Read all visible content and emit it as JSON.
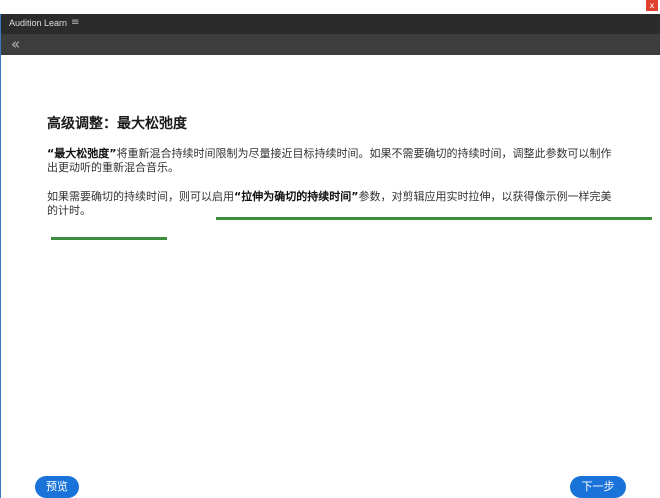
{
  "window": {
    "title": "Audition Learn",
    "close_label": "x"
  },
  "nav": {
    "back_glyph": "«",
    "menu_glyph": "≡"
  },
  "content": {
    "heading": "高级调整：最大松弛度",
    "p1_bold": "“最大松弛度”",
    "p1_rest": "将重新混合持续时间限制为尽量接近目标持续时间。如果不需要确切的持续时间，调整此参数可以制作出更动听的重新混合音乐。",
    "p2_start": "如果需要确切的持续时间，则可以启用",
    "p2_bold": "“拉伸为确切的持续时间”",
    "p2_end": "参数，对剪辑应用实时拉伸，以获得像示例一样完美的计时。"
  },
  "buttons": {
    "preview": "预览",
    "next": "下一步"
  },
  "colors": {
    "accent_blue": "#1a73d9",
    "underline_green": "#3e8c3e",
    "titlebar": "#2b2b2b",
    "navbar": "#3d3d3d"
  }
}
